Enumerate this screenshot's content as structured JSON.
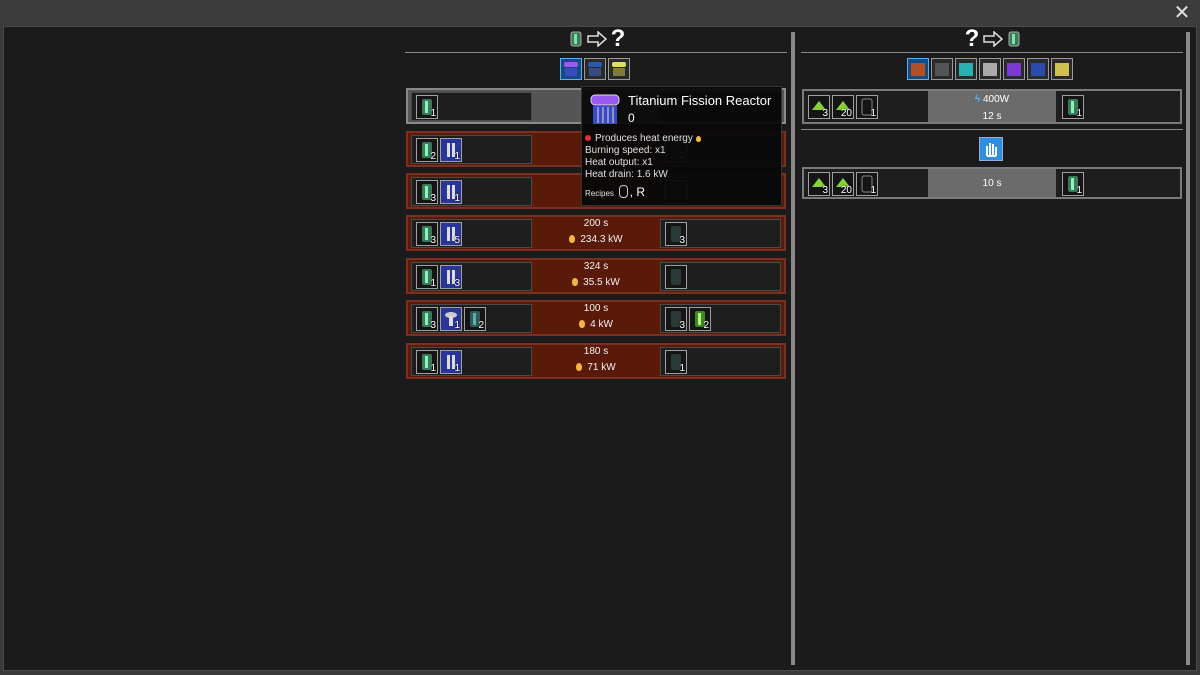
{
  "window": {
    "close_glyph": "✕"
  },
  "left_panel": {
    "header": {
      "question_mark": "?"
    },
    "tabs": [
      "purple-reactor-icon",
      "blue-reactor-icon",
      "yellow-reactor-icon"
    ],
    "rows": [
      {
        "inputs": [
          {
            "n": "1",
            "kind": "fuel-rod"
          }
        ],
        "time": "",
        "power": "",
        "outputs": []
      },
      {
        "inputs": [
          {
            "n": "2",
            "kind": "fuel-rod"
          },
          {
            "n": "1",
            "kind": "blue-rod"
          }
        ],
        "time": "",
        "power": "",
        "outputs": [
          {
            "n": "2",
            "kind": "spent-rod"
          }
        ]
      },
      {
        "inputs": [
          {
            "n": "3",
            "kind": "fuel-rod"
          },
          {
            "n": "1",
            "kind": "blue-rod"
          }
        ],
        "time": "",
        "power": "",
        "outputs": []
      },
      {
        "inputs": [
          {
            "n": "3",
            "kind": "fuel-rod"
          },
          {
            "n": "5",
            "kind": "blue-rod"
          }
        ],
        "time": "200 s",
        "power": "234.3 kW",
        "outputs": [
          {
            "n": "3",
            "kind": "spent-rod"
          }
        ]
      },
      {
        "inputs": [
          {
            "n": "1",
            "kind": "fuel-rod"
          },
          {
            "n": "3",
            "kind": "blue-rod"
          }
        ],
        "time": "324 s",
        "power": "35.5 kW",
        "outputs": [
          {
            "n": "",
            "kind": "spent-rod"
          }
        ]
      },
      {
        "inputs": [
          {
            "n": "3",
            "kind": "fuel-rod"
          },
          {
            "n": "1",
            "kind": "blue-capsule"
          },
          {
            "n": "2",
            "kind": "fuel-rod"
          }
        ],
        "time": "100 s",
        "power": "4 kW",
        "outputs": [
          {
            "n": "3",
            "kind": "spent-rod"
          },
          {
            "n": "2",
            "kind": "green-cell"
          }
        ]
      },
      {
        "inputs": [
          {
            "n": "1",
            "kind": "fuel-rod"
          },
          {
            "n": "1",
            "kind": "blue-rod"
          }
        ],
        "time": "180 s",
        "power": "71 kW",
        "outputs": [
          {
            "n": "1",
            "kind": "spent-rod"
          }
        ]
      }
    ]
  },
  "tooltip": {
    "title": "Titanium Fission Reactor",
    "count": "0",
    "produces": "Produces heat energy",
    "burning_speed": "Burning speed: x1",
    "heat_output": "Heat output: x1",
    "heat_drain": "Heat drain: 1.6 kW",
    "recipes_label": "Recipes",
    "recipes_key": ", R"
  },
  "right_panel": {
    "header": {
      "question_mark": "?"
    },
    "tabs": [
      "orange-machine-icon",
      "gray-machine-icon",
      "teal-machine-icon",
      "silver-machine-icon",
      "purple-machine-icon",
      "blue-machine-icon",
      "yellow-machine-icon"
    ],
    "rows": [
      {
        "inputs": [
          {
            "n": "3",
            "kind": "green-ore"
          },
          {
            "n": "20",
            "kind": "green-ore"
          },
          {
            "n": "1",
            "kind": "empty-rod"
          }
        ],
        "power": "400W",
        "time": "12 s",
        "outputs": [
          {
            "n": "1",
            "kind": "fuel-rod"
          }
        ]
      },
      {
        "inputs": [
          {
            "n": "3",
            "kind": "green-ore"
          },
          {
            "n": "20",
            "kind": "green-ore"
          },
          {
            "n": "1",
            "kind": "empty-rod"
          }
        ],
        "power": "",
        "time": "10 s",
        "outputs": [
          {
            "n": "1",
            "kind": "fuel-rod"
          }
        ]
      }
    ]
  },
  "colors": {
    "fuel_row": "#5a1a0a",
    "accent": "#2d8fe0"
  }
}
